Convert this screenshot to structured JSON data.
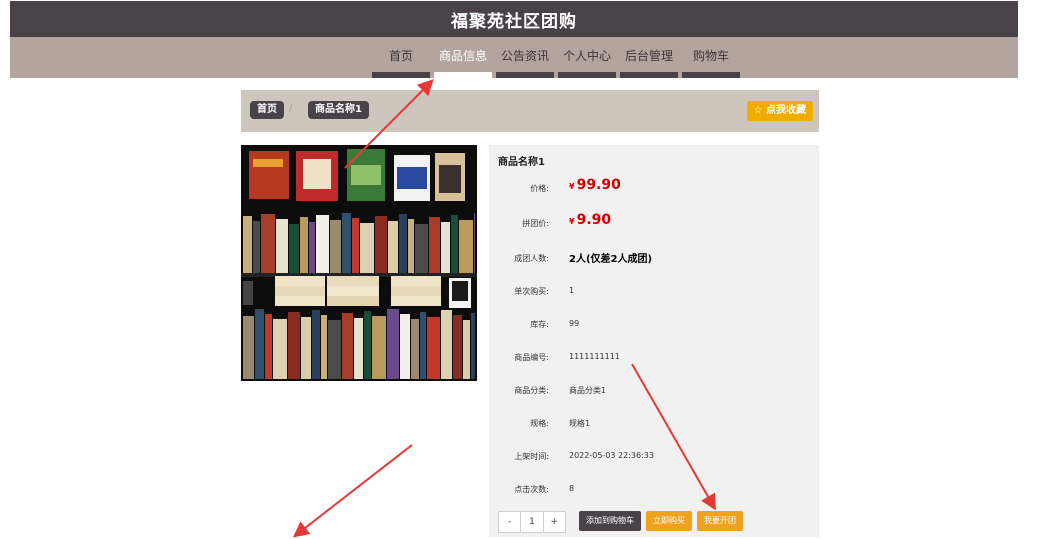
{
  "site_title": "福聚苑社区团购",
  "nav": [
    "首页",
    "商品信息",
    "公告资讯",
    "个人中心",
    "后台管理",
    "购物车"
  ],
  "nav_active_index": 1,
  "breadcrumb": {
    "home": "首页",
    "sep": "/",
    "current": "商品名称1"
  },
  "favorite_button": "☆ 点我收藏",
  "product": {
    "name": "商品名称1",
    "currency": "¥",
    "fields": [
      {
        "label": "价格:",
        "value": "99.90",
        "kind": "price"
      },
      {
        "label": "拼团价:",
        "value": "9.90",
        "kind": "price"
      },
      {
        "label": "成团人数:",
        "value": "2人(仅差2人成团)",
        "kind": "bold"
      },
      {
        "label": "单次购买:",
        "value": "1",
        "kind": "text"
      },
      {
        "label": "库存:",
        "value": "99",
        "kind": "text"
      },
      {
        "label": "商品编号:",
        "value": "1111111111",
        "kind": "text"
      },
      {
        "label": "商品分类:",
        "value": "商品分类1",
        "kind": "text"
      },
      {
        "label": "规格:",
        "value": "规格1",
        "kind": "text"
      },
      {
        "label": "上架时间:",
        "value": "2022-05-03 22:36:33",
        "kind": "text"
      },
      {
        "label": "点击次数:",
        "value": "8",
        "kind": "text"
      }
    ]
  },
  "quantity": {
    "minus": "-",
    "value": "1",
    "plus": "+"
  },
  "buttons": {
    "add_cart": "添加到购物车",
    "buy_now": "立即购买",
    "start_group": "我要开团"
  },
  "colors": {
    "header": "#4a4249",
    "nav": "#b3a59e",
    "accent": "#f0ad00",
    "price": "#d40000",
    "annotation": "#e53935"
  }
}
